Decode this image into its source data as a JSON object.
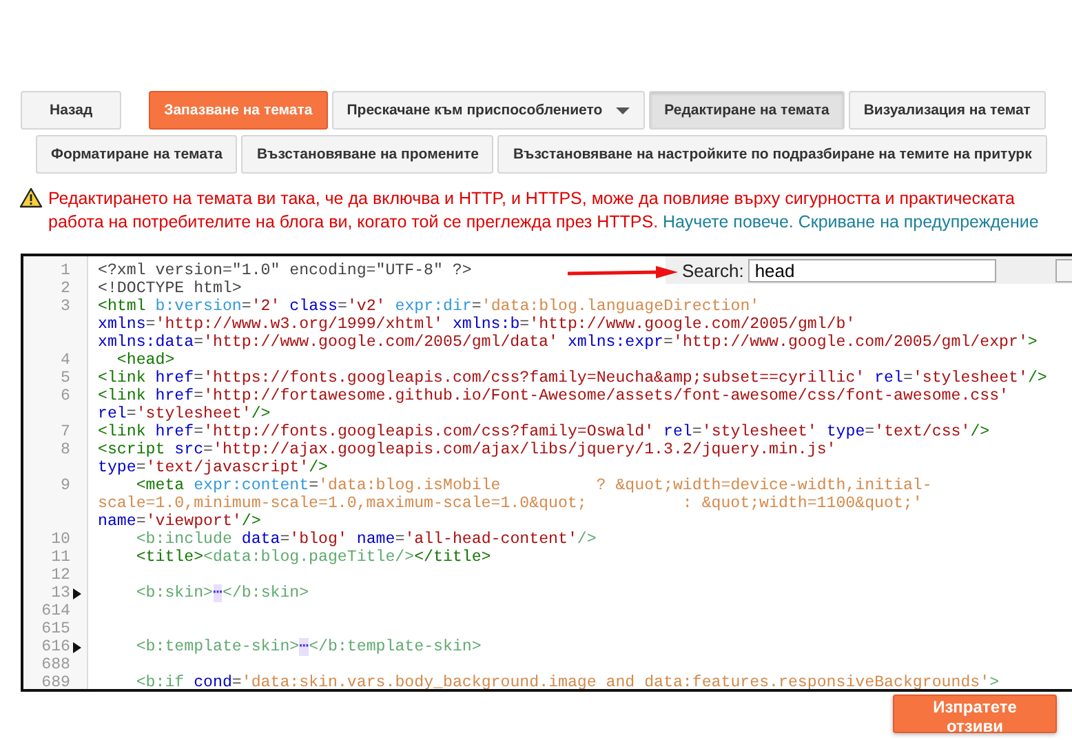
{
  "toolbar_primary": [
    {
      "label": "Назад",
      "kind": "default",
      "selected": false
    },
    {
      "label": "Запазване на темата",
      "kind": "primary",
      "selected": false
    },
    {
      "label": "Прескачане към приспособлението",
      "kind": "dropdown",
      "selected": false
    },
    {
      "label": "Редактиране на темата",
      "kind": "default",
      "selected": true
    },
    {
      "label": "Визуализация на темат",
      "kind": "default",
      "selected": false
    }
  ],
  "toolbar_secondary": [
    "Форматиране на темата",
    "Възстановяване на промените",
    "Възстановяване на настройките по подразбиране на темите на притурк"
  ],
  "warning": {
    "text": "Редактирането на темата ви така, че да включва и HTTP, и HTTPS, може да повлияе върху сигурността и практическата работа на потребителите на блога ви, когато той се преглежда през HTTPS.",
    "links": [
      "Научете повече.",
      "Скриване на предупреждение"
    ]
  },
  "editor": {
    "search": {
      "label": "Search:",
      "value": "head"
    },
    "rows": [
      {
        "number": "1",
        "folded": false,
        "tokens": [
          {
            "kind": "plain",
            "text": "<?xml version=\"1.0\" encoding=\"UTF-8\" ?>"
          }
        ]
      },
      {
        "number": "2",
        "folded": false,
        "tokens": [
          {
            "kind": "plain",
            "text": "<!DOCTYPE html>"
          }
        ]
      },
      {
        "number": "3",
        "folded": false,
        "tokens": [
          {
            "kind": "tag",
            "text": "<html"
          },
          {
            "kind": "xattr",
            "text": " b:version"
          },
          {
            "kind": "plain",
            "text": "="
          },
          {
            "kind": "str",
            "text": "'2'"
          },
          {
            "kind": "attr",
            "text": " class"
          },
          {
            "kind": "plain",
            "text": "="
          },
          {
            "kind": "str",
            "text": "'v2'"
          },
          {
            "kind": "xattr",
            "text": " expr:dir"
          },
          {
            "kind": "plain",
            "text": "="
          },
          {
            "kind": "expr",
            "text": "'data:blog.languageDirection'"
          }
        ]
      },
      {
        "tokens": [
          {
            "kind": "attr",
            "text": "xmlns"
          },
          {
            "kind": "plain",
            "text": "="
          },
          {
            "kind": "str",
            "text": "'http://www.w3.org/1999/xhtml'"
          },
          {
            "kind": "attr",
            "text": " xmlns:b"
          },
          {
            "kind": "plain",
            "text": "="
          },
          {
            "kind": "str",
            "text": "'http://www.google.com/2005/gml/b'"
          }
        ]
      },
      {
        "tokens": [
          {
            "kind": "attr",
            "text": "xmlns:data"
          },
          {
            "kind": "plain",
            "text": "="
          },
          {
            "kind": "str",
            "text": "'http://www.google.com/2005/gml/data'"
          },
          {
            "kind": "attr",
            "text": " xmlns:expr"
          },
          {
            "kind": "plain",
            "text": "="
          },
          {
            "kind": "str",
            "text": "'http://www.google.com/2005/gml/expr'"
          },
          {
            "kind": "tag",
            "text": ">"
          }
        ]
      },
      {
        "number": "4",
        "folded": false,
        "tokens": [
          {
            "kind": "tag",
            "text": "  <head>"
          }
        ]
      },
      {
        "number": "5",
        "folded": false,
        "tokens": [
          {
            "kind": "tag",
            "text": "<link"
          },
          {
            "kind": "attr",
            "text": " href"
          },
          {
            "kind": "plain",
            "text": "="
          },
          {
            "kind": "str",
            "text": "'https://fonts.googleapis.com/css?family=Neucha&amp;subset==cyrillic'"
          },
          {
            "kind": "attr",
            "text": " rel"
          },
          {
            "kind": "plain",
            "text": "="
          },
          {
            "kind": "str",
            "text": "'stylesheet'"
          },
          {
            "kind": "tag",
            "text": "/>"
          }
        ]
      },
      {
        "number": "6",
        "folded": false,
        "tokens": [
          {
            "kind": "tag",
            "text": "<link"
          },
          {
            "kind": "attr",
            "text": " href"
          },
          {
            "kind": "plain",
            "text": "="
          },
          {
            "kind": "str",
            "text": "'http://fortawesome.github.io/Font-Awesome/assets/font-awesome/css/font-awesome.css'"
          }
        ]
      },
      {
        "tokens": [
          {
            "kind": "attr",
            "text": "rel"
          },
          {
            "kind": "plain",
            "text": "="
          },
          {
            "kind": "str",
            "text": "'stylesheet'"
          },
          {
            "kind": "tag",
            "text": "/>"
          }
        ]
      },
      {
        "number": "7",
        "folded": false,
        "tokens": [
          {
            "kind": "tag",
            "text": "<link"
          },
          {
            "kind": "attr",
            "text": " href"
          },
          {
            "kind": "plain",
            "text": "="
          },
          {
            "kind": "str",
            "text": "'http://fonts.googleapis.com/css?family=Oswald'"
          },
          {
            "kind": "attr",
            "text": " rel"
          },
          {
            "kind": "plain",
            "text": "="
          },
          {
            "kind": "str",
            "text": "'stylesheet'"
          },
          {
            "kind": "attr",
            "text": " type"
          },
          {
            "kind": "plain",
            "text": "="
          },
          {
            "kind": "str",
            "text": "'text/css'"
          },
          {
            "kind": "tag",
            "text": "/>"
          }
        ]
      },
      {
        "number": "8",
        "folded": false,
        "tokens": [
          {
            "kind": "tag",
            "text": "<script"
          },
          {
            "kind": "attr",
            "text": " src"
          },
          {
            "kind": "plain",
            "text": "="
          },
          {
            "kind": "str",
            "text": "'http://ajax.googleapis.com/ajax/libs/jquery/1.3.2/jquery.min.js'"
          }
        ]
      },
      {
        "tokens": [
          {
            "kind": "attr",
            "text": "type"
          },
          {
            "kind": "plain",
            "text": "="
          },
          {
            "kind": "str",
            "text": "'text/javascript'"
          },
          {
            "kind": "tag",
            "text": "/>"
          }
        ]
      },
      {
        "number": "9",
        "folded": false,
        "tokens": [
          {
            "kind": "tag",
            "text": "    <meta"
          },
          {
            "kind": "xattr",
            "text": " expr:content"
          },
          {
            "kind": "plain",
            "text": "="
          },
          {
            "kind": "expr",
            "text": "'data:blog.isMobile          ? &quot;width=device-width,initial-"
          }
        ]
      },
      {
        "tokens": [
          {
            "kind": "expr",
            "text": "scale=1.0,minimum-scale=1.0,maximum-scale=1.0&quot;          : &quot;width=1100&quot;'"
          }
        ]
      },
      {
        "tokens": [
          {
            "kind": "attr",
            "text": "name"
          },
          {
            "kind": "plain",
            "text": "="
          },
          {
            "kind": "str",
            "text": "'viewport'"
          },
          {
            "kind": "tag",
            "text": "/>"
          }
        ]
      },
      {
        "number": "10",
        "folded": false,
        "tokens": [
          {
            "kind": "btag",
            "text": "    <b:include"
          },
          {
            "kind": "attr",
            "text": " data"
          },
          {
            "kind": "plain",
            "text": "="
          },
          {
            "kind": "str",
            "text": "'blog'"
          },
          {
            "kind": "attr",
            "text": " name"
          },
          {
            "kind": "plain",
            "text": "="
          },
          {
            "kind": "str",
            "text": "'all-head-content'"
          },
          {
            "kind": "btag",
            "text": "/>"
          }
        ]
      },
      {
        "number": "11",
        "folded": false,
        "tokens": [
          {
            "kind": "tag",
            "text": "    <title>"
          },
          {
            "kind": "btag",
            "text": "<data:blog.pageTitle/>"
          },
          {
            "kind": "tag",
            "text": "</title>"
          }
        ]
      },
      {
        "number": "12",
        "folded": false
      },
      {
        "number": "13",
        "folded": true,
        "tokens": [
          {
            "kind": "btag",
            "text": "    <b:skin>"
          },
          {
            "kind": "fold",
            "text": "⋯"
          },
          {
            "kind": "btag",
            "text": "</b:skin>"
          }
        ]
      },
      {
        "number": "614",
        "folded": false
      },
      {
        "number": "615",
        "folded": false
      },
      {
        "number": "616",
        "folded": true,
        "tokens": [
          {
            "kind": "btag",
            "text": "    <b:template-skin>"
          },
          {
            "kind": "fold",
            "text": "⋯"
          },
          {
            "kind": "btag",
            "text": "</b:template-skin>"
          }
        ]
      },
      {
        "number": "688",
        "folded": false
      },
      {
        "number": "689",
        "folded": false,
        "tokens": [
          {
            "kind": "btag",
            "text": "    <b:if"
          },
          {
            "kind": "attr",
            "text": " cond"
          },
          {
            "kind": "plain",
            "text": "="
          },
          {
            "kind": "expr",
            "text": "'data:skin.vars.body_background.image and data:features.responsiveBackgrounds'"
          },
          {
            "kind": "btag",
            "text": ">"
          }
        ]
      }
    ]
  },
  "feedback_button": "Изпратете отзиви"
}
